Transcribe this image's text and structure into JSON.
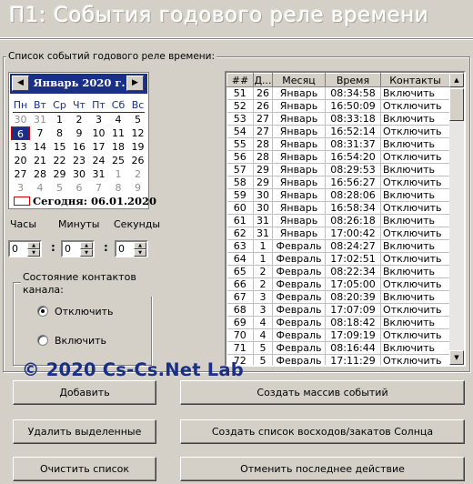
{
  "window": {
    "title": "П1:  События годового реле времени"
  },
  "events_group": {
    "caption": "Список событий годового реле времени:"
  },
  "calendar": {
    "month_label": "Январь 2020 г.",
    "prev_glyph": "◀",
    "next_glyph": "▶",
    "weekdays": [
      "Пн",
      "Вт",
      "Ср",
      "Чт",
      "Пт",
      "Сб",
      "Вс"
    ],
    "weeks": [
      [
        "30",
        "31",
        "1",
        "2",
        "3",
        "4",
        "5"
      ],
      [
        "6",
        "7",
        "8",
        "9",
        "10",
        "11",
        "12"
      ],
      [
        "13",
        "14",
        "15",
        "16",
        "17",
        "18",
        "19"
      ],
      [
        "20",
        "21",
        "22",
        "23",
        "24",
        "25",
        "26"
      ],
      [
        "27",
        "28",
        "29",
        "30",
        "31",
        "1",
        "2"
      ],
      [
        "3",
        "4",
        "5",
        "6",
        "7",
        "8",
        "9"
      ]
    ],
    "selected_day": "6",
    "today_label": "Сегодня: 06.01.2020",
    "accent_color": "#1a2f86"
  },
  "time": {
    "hours_label": "Часы",
    "minutes_label": "Минуты",
    "seconds_label": "Секунды",
    "hours_value": "0",
    "minutes_value": "0",
    "seconds_value": "0",
    "separator": ":"
  },
  "contact_state": {
    "caption": "Состояние контактов канала:",
    "options": [
      {
        "label": "Отключить",
        "checked": true
      },
      {
        "label": "Включить",
        "checked": false
      }
    ]
  },
  "table": {
    "columns": [
      "##",
      "Д...",
      "Месяц",
      "Время",
      "Контакты"
    ],
    "rows": [
      [
        "51",
        "26",
        "Январь",
        "08:34:58",
        "Включить"
      ],
      [
        "52",
        "26",
        "Январь",
        "16:50:09",
        "Отключить"
      ],
      [
        "53",
        "27",
        "Январь",
        "08:33:18",
        "Включить"
      ],
      [
        "54",
        "27",
        "Январь",
        "16:52:14",
        "Отключить"
      ],
      [
        "55",
        "28",
        "Январь",
        "08:31:37",
        "Включить"
      ],
      [
        "56",
        "28",
        "Январь",
        "16:54:20",
        "Отключить"
      ],
      [
        "57",
        "29",
        "Январь",
        "08:29:53",
        "Включить"
      ],
      [
        "58",
        "29",
        "Январь",
        "16:56:27",
        "Отключить"
      ],
      [
        "59",
        "30",
        "Январь",
        "08:28:06",
        "Включить"
      ],
      [
        "60",
        "30",
        "Январь",
        "16:58:34",
        "Отключить"
      ],
      [
        "61",
        "31",
        "Январь",
        "08:26:18",
        "Включить"
      ],
      [
        "62",
        "31",
        "Январь",
        "17:00:42",
        "Отключить"
      ],
      [
        "63",
        "1",
        "Февраль",
        "08:24:27",
        "Включить"
      ],
      [
        "64",
        "1",
        "Февраль",
        "17:02:51",
        "Отключить"
      ],
      [
        "65",
        "2",
        "Февраль",
        "08:22:34",
        "Включить"
      ],
      [
        "66",
        "2",
        "Февраль",
        "17:05:00",
        "Отключить"
      ],
      [
        "67",
        "3",
        "Февраль",
        "08:20:39",
        "Включить"
      ],
      [
        "68",
        "3",
        "Февраль",
        "17:07:09",
        "Отключить"
      ],
      [
        "69",
        "4",
        "Февраль",
        "08:18:42",
        "Включить"
      ],
      [
        "70",
        "4",
        "Февраль",
        "17:09:19",
        "Отключить"
      ],
      [
        "71",
        "5",
        "Февраль",
        "08:16:44",
        "Включить"
      ],
      [
        "72",
        "5",
        "Февраль",
        "17:11:29",
        "Отключить"
      ]
    ]
  },
  "watermark": "© 2020 Cs-Cs.Net Lab",
  "buttons": {
    "add": "Добавить",
    "create_array": "Создать массив событий",
    "delete_selected": "Удалить выделенные",
    "create_sun_list": "Создать список восходов/закатов Солнца",
    "clear_list": "Очистить список",
    "undo_last": "Отменить последнее действие"
  }
}
